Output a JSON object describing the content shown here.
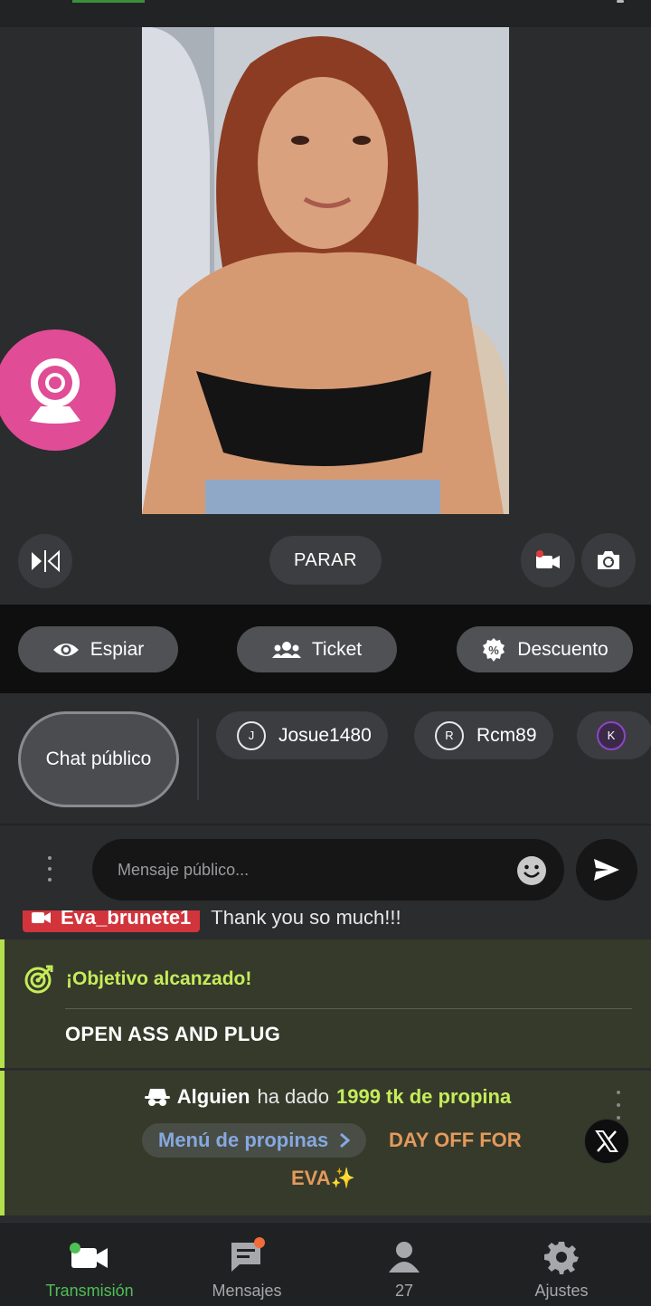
{
  "controls": {
    "stop_label": "PARAR"
  },
  "actions": [
    {
      "label": "Espiar",
      "icon": "eye-icon"
    },
    {
      "label": "Ticket",
      "icon": "users-icon"
    },
    {
      "label": "Descuento",
      "icon": "discount-icon"
    }
  ],
  "chat_tabs": {
    "public_label": "Chat público",
    "users": [
      {
        "initial": "J",
        "name": "Josue1480"
      },
      {
        "initial": "R",
        "name": "Rcm89"
      },
      {
        "initial": "K",
        "name": ""
      }
    ]
  },
  "composer": {
    "placeholder": "Mensaje público..."
  },
  "feed": {
    "partial_message": {
      "user": "Eva_brunete1",
      "text": "Thank you so much!!!"
    },
    "goal": {
      "title": "¡Objetivo alcanzado!",
      "text": "OPEN ASS AND PLUG"
    },
    "tip": {
      "who": "Alguien",
      "verb": "ha dado",
      "amount": "1999 tk de propina",
      "menu_label": "Menú de propinas",
      "item_line1": "DAY OFF FOR",
      "item_line2": "EVA✨"
    }
  },
  "tabbar": [
    {
      "label": "Transmisión",
      "icon": "video-camera-icon",
      "active": true
    },
    {
      "label": "Mensajes",
      "icon": "messages-icon"
    },
    {
      "label": "27",
      "icon": "person-icon"
    },
    {
      "label": "Ajustes",
      "icon": "gear-icon"
    }
  ],
  "colors": {
    "accent_green": "#4fbf57",
    "goal_green": "#c6ec5a",
    "cam_pink": "#e04c96",
    "tip_orange": "#e39a5b",
    "menu_blue": "#86a8e0"
  }
}
